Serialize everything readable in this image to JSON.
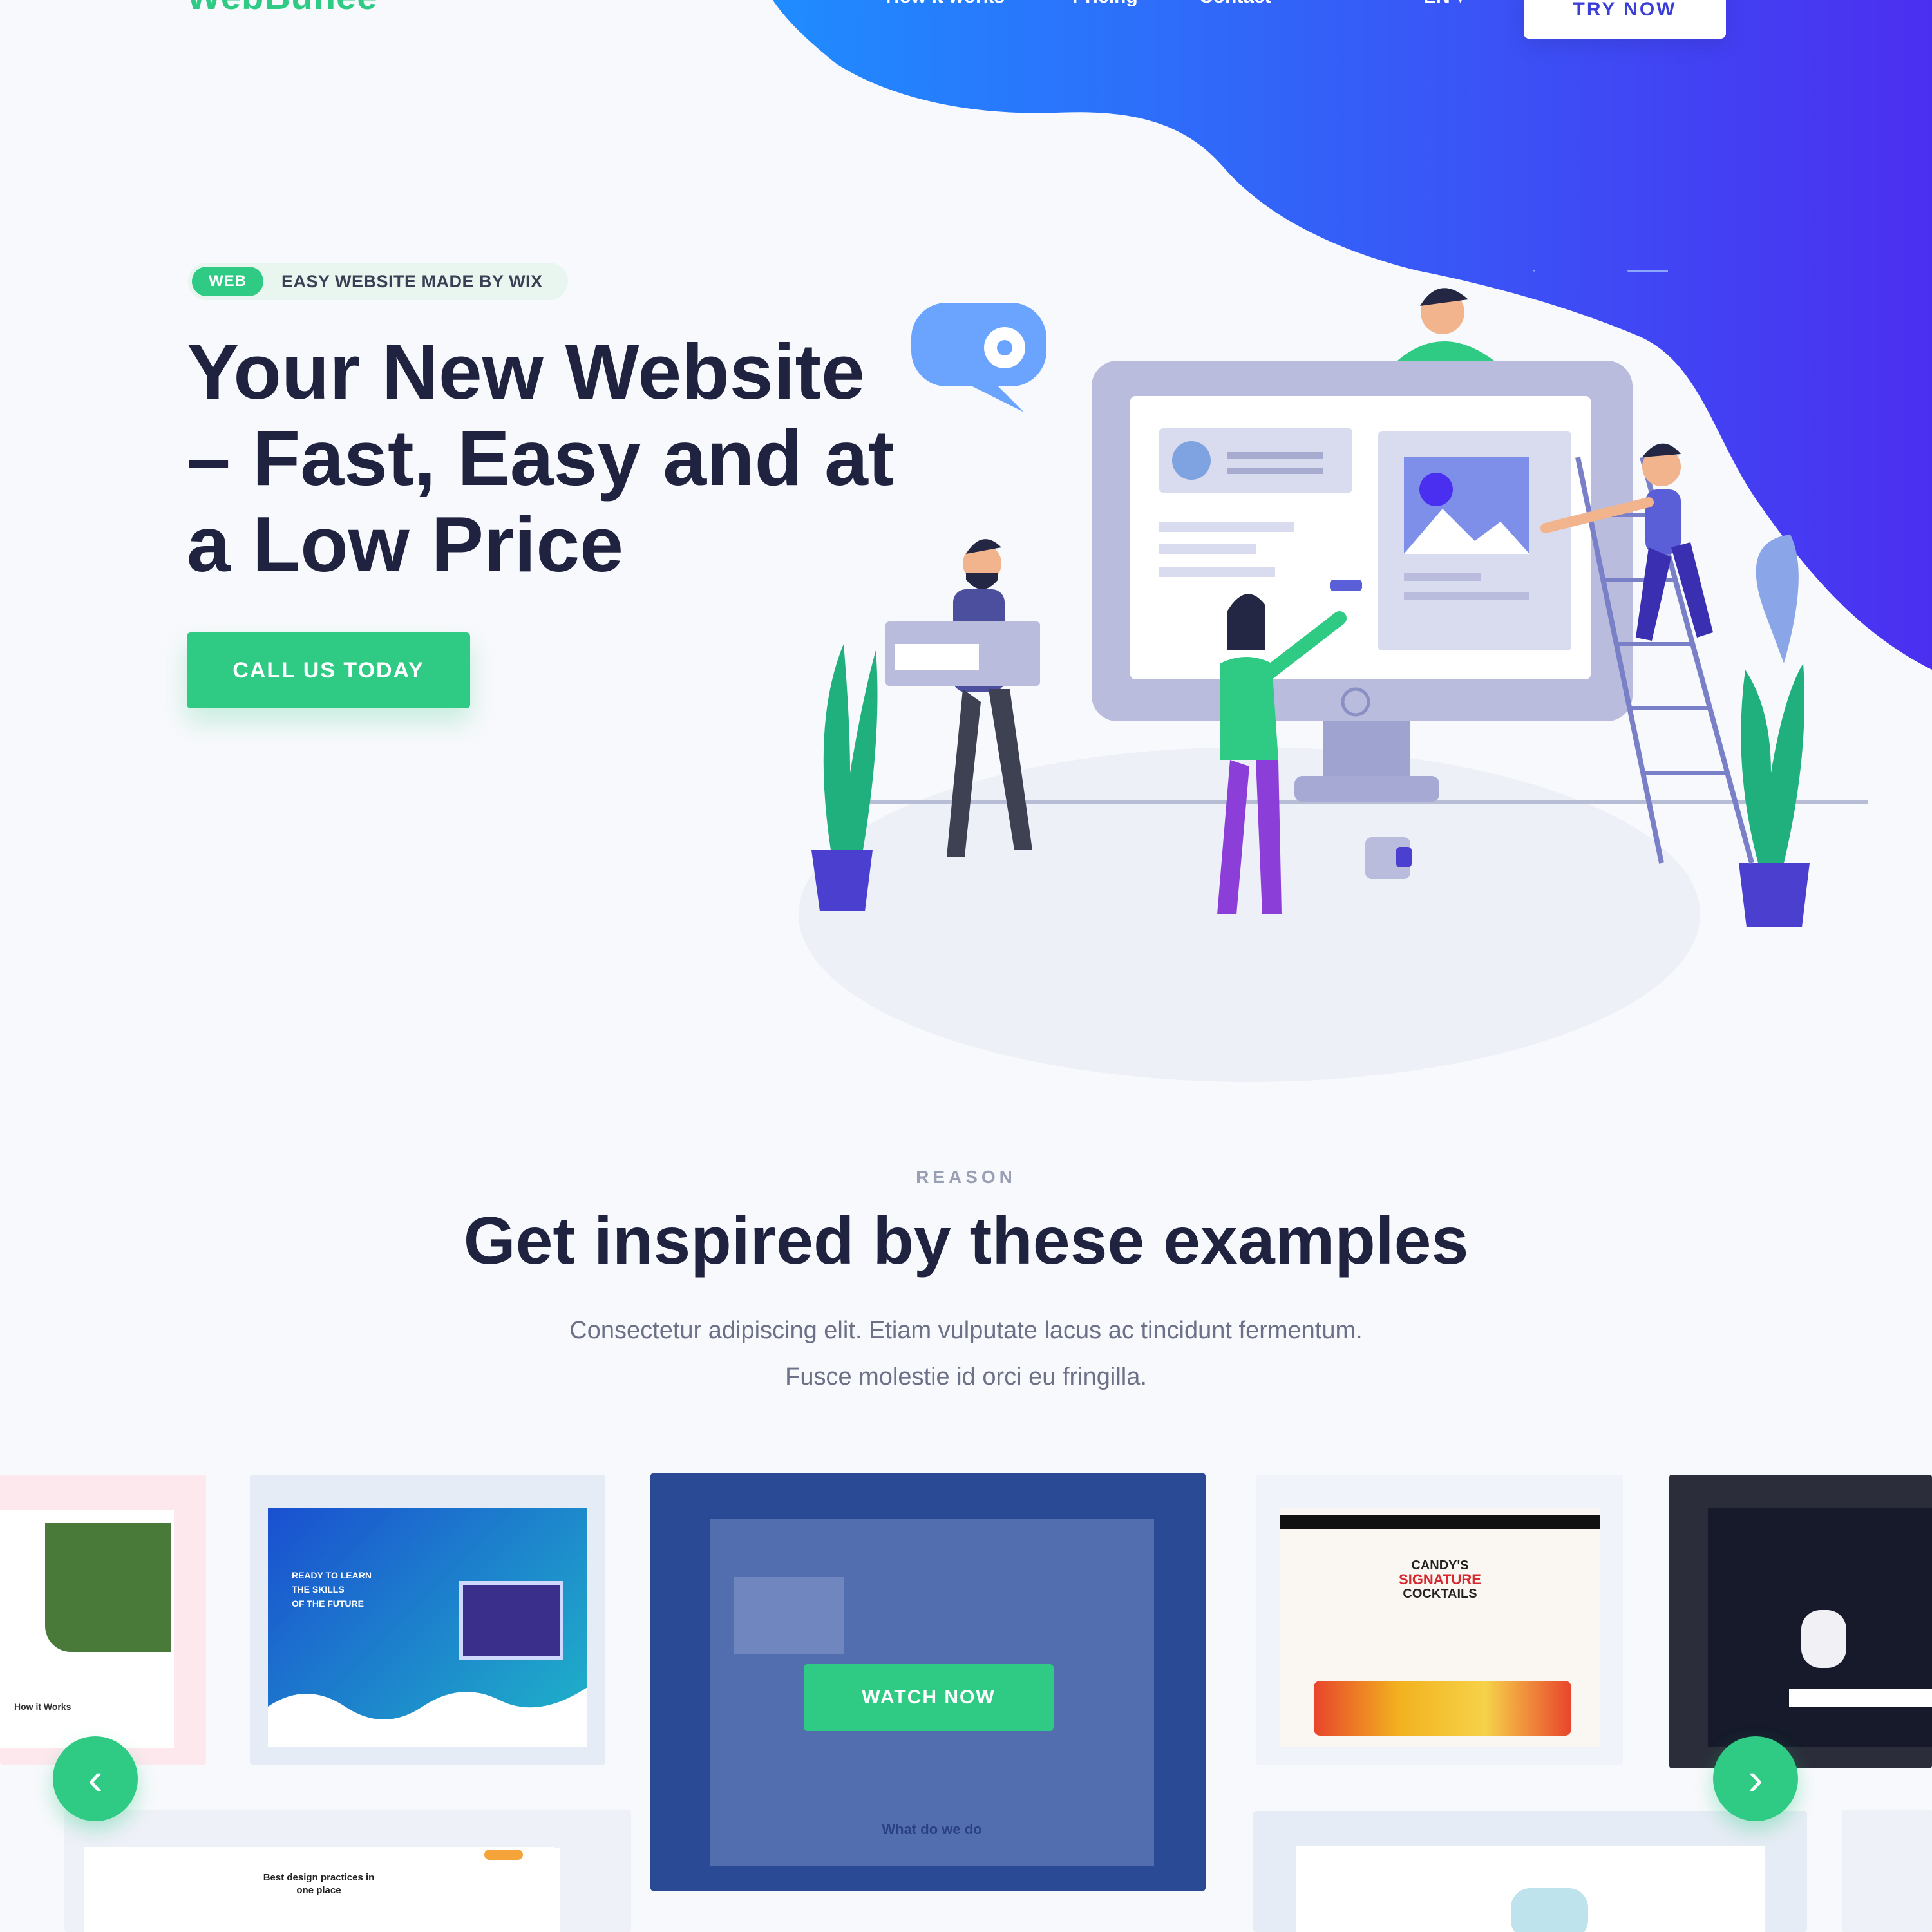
{
  "header": {
    "logo": "WebBunee",
    "nav": [
      "How it works",
      "Pricing",
      "Contact"
    ],
    "lang": "EN ▾",
    "cta": "TRY NOW"
  },
  "hero": {
    "badge_pill": "WEB",
    "badge_text": "EASY WEBSITE MADE BY WIX",
    "title_lines": [
      "Your New Website",
      "– Fast, Easy and at",
      "a Low Price"
    ],
    "cta": "CALL US TODAY"
  },
  "section": {
    "eyebrow": "REASON",
    "title": "Get inspired by these examples",
    "subtitle_lines": [
      "Consectetur adipiscing elit. Etiam vulputate lacus ac tincidunt fermentum.",
      "Fusce molestie id orci eu fringilla."
    ]
  },
  "gallery": {
    "watch_label": "WATCH NOW",
    "card_texts": {
      "learn": [
        "READY TO LEARN",
        "THE SKILLS",
        "OF THE FUTURE"
      ],
      "cocktails": [
        "CANDY'S",
        "SIGNATURE",
        "COCKTAILS"
      ],
      "best_design": [
        "Best design practices in",
        "one place"
      ],
      "what_we_do": "What do we do",
      "how_it_works": "How it Works"
    },
    "arrows": {
      "prev": "‹",
      "next": "›"
    }
  },
  "colors": {
    "accent_green": "#2fcb85",
    "gradient_start": "#1f8cff",
    "gradient_end": "#4b2ff0",
    "navy_text": "#1f2340"
  }
}
